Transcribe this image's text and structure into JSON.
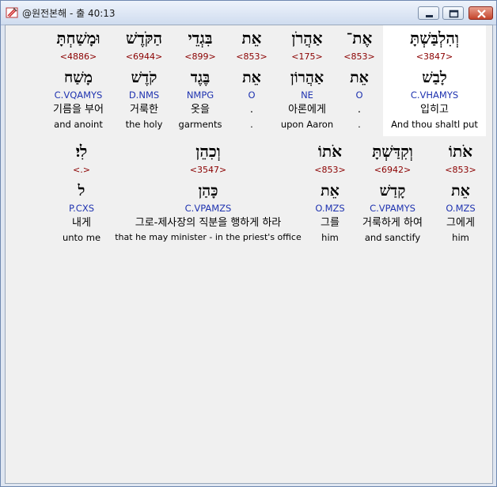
{
  "window": {
    "title": "@원전본해 - 출 40:13"
  },
  "rows": [
    {
      "words": [
        {
          "hebrew": "וּמָשַׁחְתָּ",
          "strong": "<4886>",
          "lemma": "מָשַׁח",
          "morph": "C.VQAMYS",
          "korean": "기름을 부어",
          "english": "and anoint"
        },
        {
          "hebrew": "הַקֹּדֶשׁ",
          "strong": "<6944>",
          "lemma": "קֹדֶשׁ",
          "morph": "D.NMS",
          "korean": "거룩한",
          "english": "the holy"
        },
        {
          "hebrew": "בִּגְדֵי",
          "strong": "<899>",
          "lemma": "בֶּגֶד",
          "morph": "NMPG",
          "korean": "옷을",
          "english": "garments"
        },
        {
          "hebrew": "אֵת",
          "strong": "<853>",
          "lemma": "אֵת",
          "morph": "O",
          "korean": ".",
          "english": "."
        },
        {
          "hebrew": "אַהֲרֹן",
          "strong": "<175>",
          "lemma": "אַהֲרוֹן",
          "morph": "NE",
          "korean": "아론에게",
          "english": "upon Aaron"
        },
        {
          "hebrew": "אֶת־",
          "strong": "<853>",
          "lemma": "אֵת",
          "morph": "O",
          "korean": ".",
          "english": "."
        },
        {
          "hebrew": "וְהִלְבַּשְׁתָּ",
          "strong": "<3847>",
          "lemma": "לָבַשׁ",
          "morph": "C.VHAMYS",
          "korean": "입히고",
          "english": "And thou shaltl put",
          "selected": true
        }
      ]
    },
    {
      "words": [
        {
          "hebrew": "לִי׃",
          "strong": "<.>",
          "lemma": "ל",
          "morph": "P.CXS",
          "korean": "내게",
          "english": "unto me"
        },
        {
          "hebrew": "וְכִהֵן",
          "strong": "<3547>",
          "lemma": "כָּהַן",
          "morph": "C.VPAMZS",
          "korean": "그로-제사장의 직분을 행하게 하라",
          "english": "that he may minister - in the priest's office"
        },
        {
          "hebrew": "אֹתוֹ",
          "strong": "<853>",
          "lemma": "אֵת",
          "morph": "O.MZS",
          "korean": "그를",
          "english": "him"
        },
        {
          "hebrew": "וְקִדַּשְׁתָּ",
          "strong": "<6942>",
          "lemma": "קָדַשׁ",
          "morph": "C.VPAMYS",
          "korean": "거룩하게 하여",
          "english": "and sanctify"
        },
        {
          "hebrew": "אֹתוֹ",
          "strong": "<853>",
          "lemma": "אֵת",
          "morph": "O.MZS",
          "korean": "그에게",
          "english": "him"
        }
      ]
    }
  ]
}
